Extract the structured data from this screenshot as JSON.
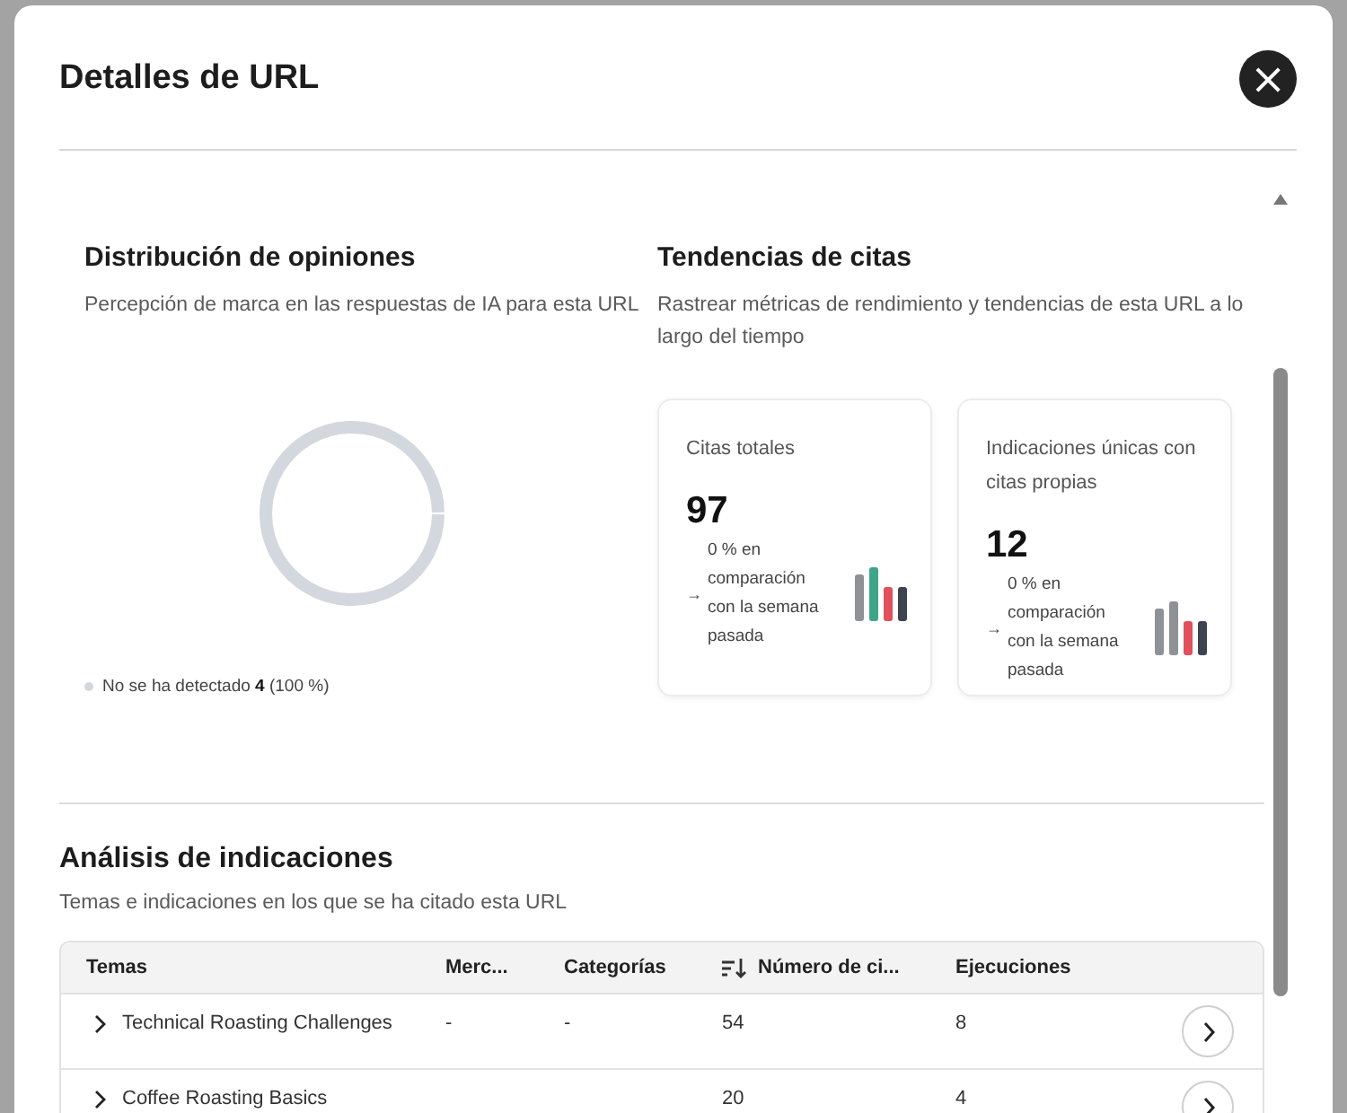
{
  "dialog": {
    "title": "Detalles de URL",
    "close_label": "×"
  },
  "sentiment": {
    "title": "Distribución de opiniones",
    "subtitle": "Percepción de marca en las respuestas de IA para esta URL",
    "legend": [
      {
        "label": "No se ha detectado **4** (100 %)",
        "color": "#d3d8de"
      }
    ]
  },
  "citations": {
    "title": "Tendencias de citas",
    "subtitle": "Rastrear métricas de rendimiento y tendencias de esta URL a lo largo del tiempo",
    "cards": [
      {
        "label": "Citas totales",
        "value": "97",
        "trend_icon": "→",
        "trend": "0 % en comparación con la semana pasada"
      },
      {
        "label": "Indicaciones únicas con citas propias",
        "value": "12",
        "trend_icon": "→",
        "trend": "0 % en comparación con la semana pasada"
      }
    ]
  },
  "prompts": {
    "title": "Análisis de indicaciones",
    "subtitle": "Temas e indicaciones en los que se ha citado esta URL",
    "table": {
      "columns": [
        {
          "label": "Temas",
          "sorted": false
        },
        {
          "label": "Merc...",
          "sorted": false
        },
        {
          "label": "Categorías",
          "sorted": false
        },
        {
          "label": "Número de ci...",
          "sorted": true
        },
        {
          "label": "Ejecuciones",
          "sorted": false
        }
      ],
      "rows": [
        {
          "cells": [
            "Technical Roasting Challenges",
            "-",
            "-",
            "54",
            "8"
          ],
          "expanded": false
        },
        {
          "cells": [
            "Coffee Roasting Basics",
            null,
            null,
            "20",
            "4"
          ],
          "expanded": false
        }
      ]
    }
  }
}
